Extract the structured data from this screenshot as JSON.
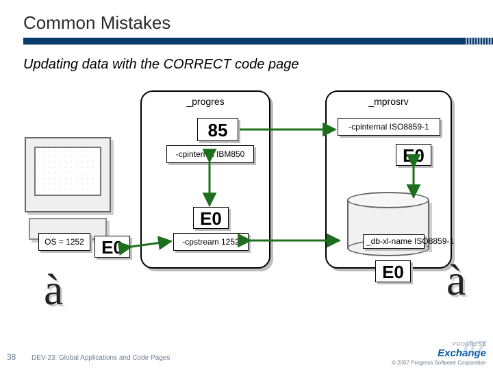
{
  "title": "Common Mistakes",
  "subtitle": "Updating data with the CORRECT code page",
  "box_left_label": "_progres",
  "box_right_label": "_mprosrv",
  "badges": {
    "b85": "85",
    "cp_iso": "-cpinternal ISO8859-1",
    "cp_ibm": "-cpinternal IBM850",
    "e0_right_top": "E0",
    "e0_mid": "E0",
    "cp_stream": "-cpstream 1252",
    "os": "OS = 1252",
    "e0_os": "E0",
    "db_xl": "_db-xl-name ISO8859-1",
    "e0_db": "E0"
  },
  "achar": "à",
  "footer": {
    "page": "38",
    "session": "DEV-23: Global Applications and Code Pages",
    "copyright": "© 2007 Progress Software Corporation",
    "logo_top": "PROGRESS",
    "logo_main": "Exchange",
    "logo_year": "07"
  }
}
